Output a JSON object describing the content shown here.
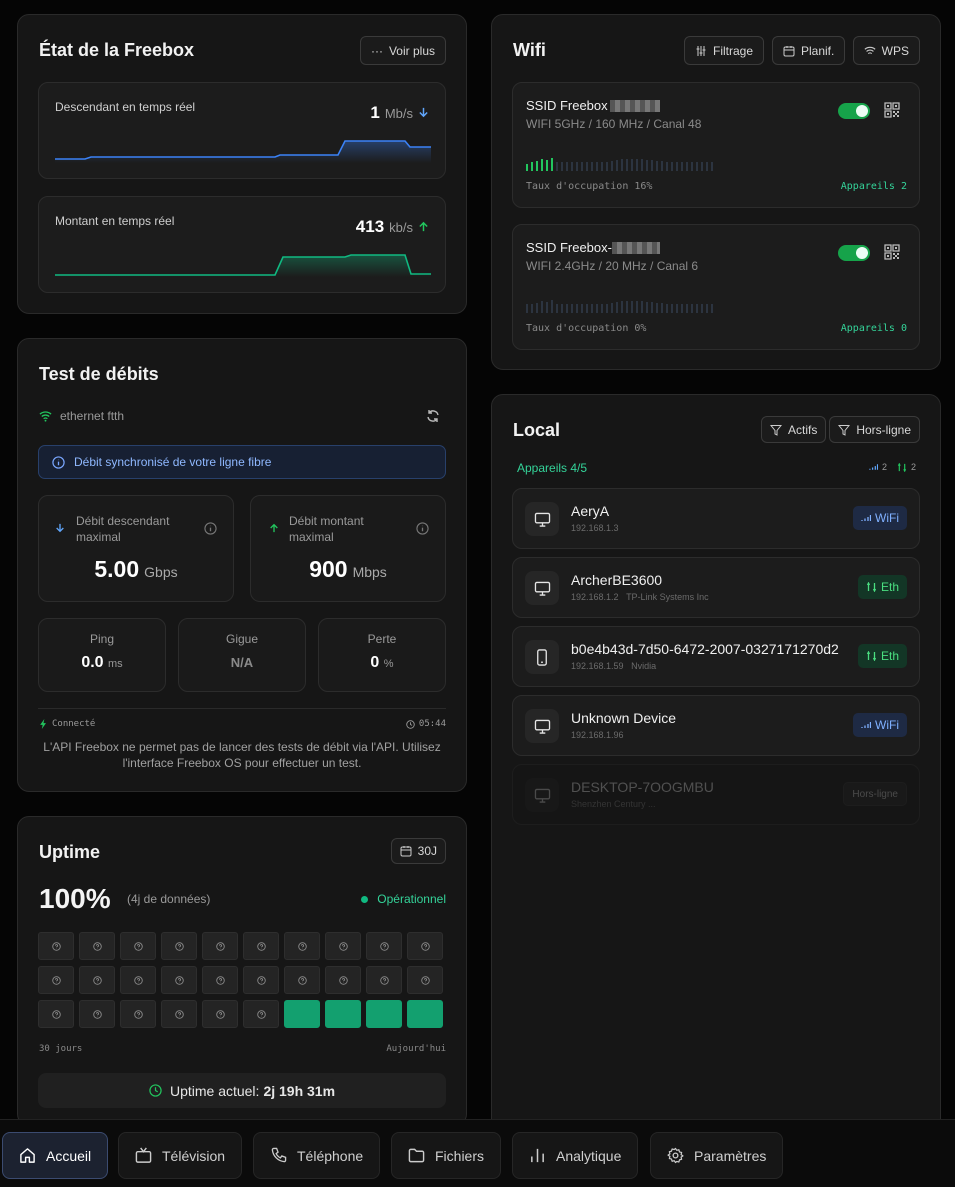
{
  "freebox": {
    "title": "État de la Freebox",
    "more_label": "Voir plus",
    "down": {
      "label": "Descendant en temps réel",
      "value": "1",
      "unit": "Mb/s"
    },
    "up": {
      "label": "Montant en temps réel",
      "value": "413",
      "unit": "kb/s"
    }
  },
  "speedtest": {
    "title": "Test de débits",
    "connection": "ethernet ftth",
    "info": "Débit synchronisé de votre ligne fibre",
    "down": {
      "label1": "Débit descendant",
      "label2": "maximal",
      "value": "5.00",
      "unit": "Gbps"
    },
    "up": {
      "label1": "Débit montant",
      "label2": "maximal",
      "value": "900",
      "unit": "Mbps"
    },
    "ping": {
      "label": "Ping",
      "value": "0.0",
      "unit": "ms"
    },
    "jitter": {
      "label": "Gigue",
      "value": "N/A"
    },
    "loss": {
      "label": "Perte",
      "value": "0",
      "unit": "%"
    },
    "status": "Connecté",
    "time": "05:44",
    "note": "L'API Freebox ne permet pas de lancer des tests de débit via l'API. Utilisez l'interface Freebox OS pour effectuer un test."
  },
  "uptime": {
    "title": "Uptime",
    "range_label": "30J",
    "percent": "100%",
    "data_note": "(4j de données)",
    "status": "Opérationnel",
    "axis_left": "30 jours",
    "axis_right": "Aujourd'hui",
    "current_label": "Uptime actuel:",
    "current_value": "2j 19h 31m",
    "days_ok": 4,
    "days_total": 30
  },
  "wifi": {
    "title": "Wifi",
    "filter_label": "Filtrage",
    "plan_label": "Planif.",
    "wps_label": "WPS",
    "networks": [
      {
        "ssid": "SSID Freebox",
        "details": "WIFI 5GHz / 160 MHz / Canal 48",
        "occupancy": "Taux d'occupation 16%",
        "devices": "Appareils 2",
        "active_bars": 6
      },
      {
        "ssid": "SSID Freebox-",
        "details": "WIFI 2.4GHz / 20 MHz / Canal 6",
        "occupancy": "Taux d'occupation 0%",
        "devices": "Appareils 0",
        "active_bars": 0
      }
    ]
  },
  "local": {
    "title": "Local",
    "active_label": "Actifs",
    "offline_label": "Hors-ligne",
    "count": "Appareils 4/5",
    "wifi_count": "2",
    "eth_count": "2",
    "devices": [
      {
        "name": "AeryA",
        "ip": "192.168.1.3",
        "vendor": "",
        "type": "WiFi",
        "icon": "monitor-icon"
      },
      {
        "name": "ArcherBE3600",
        "ip": "192.168.1.2",
        "vendor": "TP-Link Systems Inc",
        "type": "Eth",
        "icon": "monitor-icon"
      },
      {
        "name": "b0e4b43d-7d50-6472-2007-0327171270d2",
        "ip": "192.168.1.59",
        "vendor": "Nvidia",
        "type": "Eth",
        "icon": "phone-icon"
      },
      {
        "name": "Unknown Device",
        "ip": "192.168.1.96",
        "vendor": "",
        "type": "WiFi",
        "icon": "monitor-icon"
      },
      {
        "name": "DESKTOP-7OOGMBU",
        "ip": "",
        "vendor": "Shenzhen Century ...",
        "type": "Hors-ligne",
        "icon": "monitor-icon"
      }
    ]
  },
  "nav": {
    "home": "Accueil",
    "tv": "Télévision",
    "phone": "Téléphone",
    "files": "Fichiers",
    "analytics": "Analytique",
    "settings": "Paramètres"
  },
  "colors": {
    "accent_green": "#34d399",
    "accent_blue": "#60a5fa",
    "card": "#161616"
  }
}
